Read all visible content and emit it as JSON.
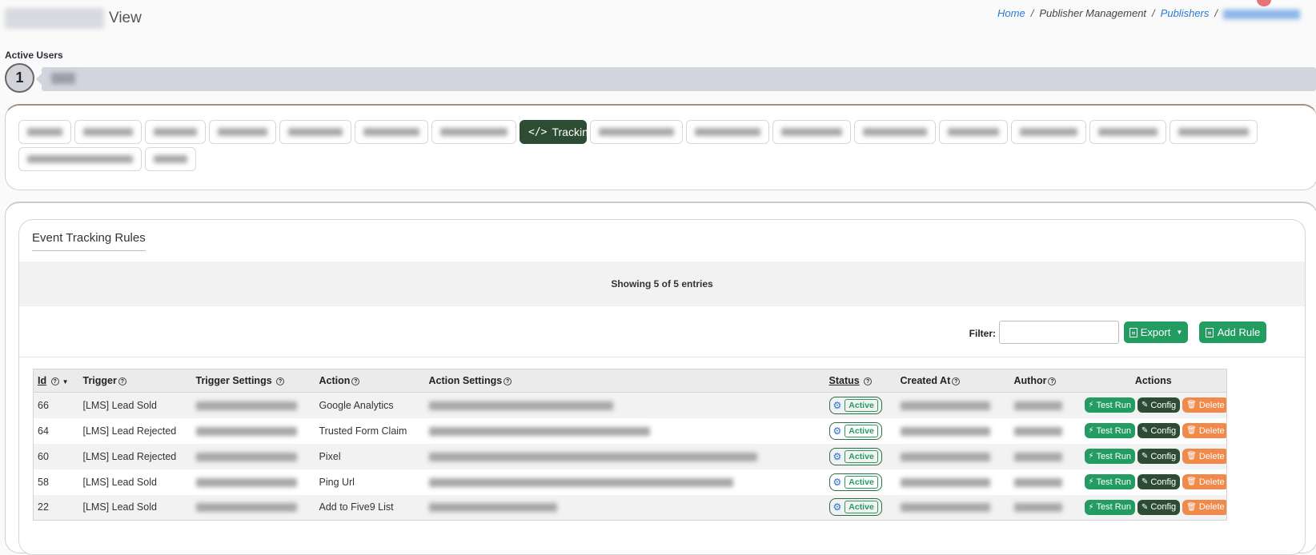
{
  "header": {
    "title_suffix": "View",
    "breadcrumb": {
      "home": "Home",
      "publisher_management": "Publisher Management",
      "publishers": "Publishers",
      "sep": "/"
    }
  },
  "active_users": {
    "label": "Active Users",
    "count": "1"
  },
  "tabs": {
    "active_label": "Tracking",
    "active_icon": "code-icon"
  },
  "card": {
    "title": "Event Tracking Rules",
    "showing": "Showing 5 of 5 entries",
    "filter_label": "Filter:",
    "filter_value": "",
    "export_label": "Export",
    "add_rule_label": "Add Rule"
  },
  "table": {
    "columns": {
      "id": "Id",
      "trigger": "Trigger",
      "trigger_settings": "Trigger Settings",
      "action": "Action",
      "action_settings": "Action Settings",
      "status": "Status",
      "created_at": "Created At",
      "author": "Author",
      "actions": "Actions"
    },
    "buttons": {
      "test_run": "Test Run",
      "config": "Config",
      "delete": "Delete"
    },
    "rows": [
      {
        "id": "66",
        "trigger": "[LMS] Lead Sold",
        "action": "Google Analytics",
        "status": "Active"
      },
      {
        "id": "64",
        "trigger": "[LMS] Lead Rejected",
        "action": "Trusted Form Claim",
        "status": "Active"
      },
      {
        "id": "60",
        "trigger": "[LMS] Lead Rejected",
        "action": "Pixel",
        "status": "Active"
      },
      {
        "id": "58",
        "trigger": "[LMS] Lead Sold",
        "action": "Ping Url",
        "status": "Active"
      },
      {
        "id": "22",
        "trigger": "[LMS] Lead Sold",
        "action": "Add to Five9 List",
        "status": "Active"
      }
    ]
  },
  "colors": {
    "primary_green": "#239c62",
    "dark_green": "#2c4c33",
    "delete_orange": "#f08a4b",
    "link_blue": "#2a7ad6"
  }
}
